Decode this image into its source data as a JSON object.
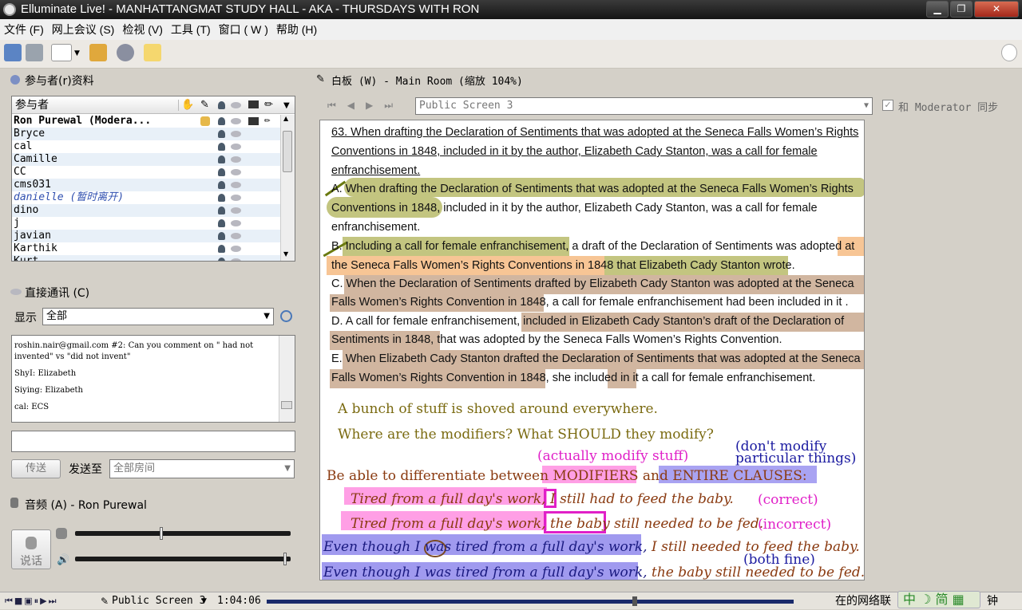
{
  "window": {
    "title": "Elluminate Live! - MANHATTANGMAT STUDY HALL - AKA - THURSDAYS WITH RON"
  },
  "menu": [
    "文件 (F)",
    "网上会议 (S)",
    "检视 (V)",
    "工具 (T)",
    "窗口 ( W )",
    "帮助 (H)"
  ],
  "participants": {
    "title": "参与者(r)资料",
    "column_header": "参与者",
    "rows": [
      {
        "name": "Ron Purewal (Modera...",
        "bold": true
      },
      {
        "name": "Bryce"
      },
      {
        "name": "cal"
      },
      {
        "name": "Camille"
      },
      {
        "name": "CC"
      },
      {
        "name": "cms031"
      },
      {
        "name": "danielle (暂时离开)",
        "away": true
      },
      {
        "name": "dino"
      },
      {
        "name": "j"
      },
      {
        "name": "javian"
      },
      {
        "name": "Karthik"
      },
      {
        "name": "Kurt"
      }
    ]
  },
  "chat": {
    "title": "直接通讯 (C)",
    "show_label": "显示",
    "filter": "全部",
    "messages": [
      "roshin.nair@gmail.com #2: Can you comment on \" had not invented\" vs \"did not invent\"",
      "ShyI: Elizabeth",
      "Siying: Elizabeth",
      "cal: ECS"
    ],
    "send_button": "传送",
    "send_to_label": "发送至",
    "send_to_value": "全部房间"
  },
  "audio": {
    "title": "音频 (A) - Ron Purewal",
    "talk_button": "说话",
    "mic_level": 0.4,
    "speaker_level": 0.98
  },
  "whiteboard": {
    "title": "白板 (W) - Main Room (缩放 104%)",
    "screen": "Public Screen 3",
    "sync_label": "和 Moderator 同步",
    "sync_checked": true,
    "question": [
      "63. When drafting the Declaration of Sentiments that was adopted at the Seneca Falls Women’s Rights",
      "Conventions in 1848, included in it by the author, Elizabeth Cady Stanton, was a call for female",
      "enfranchisement."
    ],
    "choices": [
      [
        "A. When drafting the Declaration of Sentiments that was adopted at the Seneca Falls Women’s Rights",
        "Conventions in 1848, included in it by the author, Elizabeth Cady Stanton, was a call for female",
        "enfranchisement."
      ],
      [
        "B. Including a call for female enfranchisement, a draft of the Declaration of Sentiments was adopted at",
        "the Seneca Falls Women’s Rights Conventions in 1848 that Elizabeth Cady Stanton wrote."
      ],
      [
        "C. When the Declaration of Sentiments drafted by Elizabeth Cady Stanton was adopted at the Seneca",
        "Falls Women’s Rights Convention in 1848, a call for female enfranchisement had been included in it ."
      ],
      [
        "D. A call for female enfranchisement, included in Elizabeth Cady Stanton’s draft of the Declaration of",
        "Sentiments in 1848, that was adopted by the Seneca Falls Women’s Rights Convention."
      ],
      [
        "E. When Elizabeth Cady Stanton drafted the Declaration of Sentiments that was adopted at the Seneca",
        "Falls Women’s Rights Convention in 1848, she included in it a call for female enfranchisement."
      ]
    ],
    "notes": {
      "line1": "A bunch of stuff is shoved around everywhere.",
      "line2": "Where are the modifiers?  What SHOULD they modify?",
      "dont_modify": "(don't modify",
      "particular": "particular things)",
      "actually": "(actually modify stuff)",
      "differentiate": "Be able to differentiate between",
      "modifiers": "MODIFIERS",
      "and": "and",
      "entire": "ENTIRE CLAUSES:",
      "ex1a": "Tired from a full day's work,",
      "ex1b": "I",
      "ex1c": "still had to feed the baby.",
      "correct": "(correct)",
      "ex2a": "Tired from a full day's work,",
      "ex2b": "the baby",
      "ex2c": "still needed to be fed.",
      "incorrect": "(incorrect)",
      "ex3a": "Even though I was tired from a full day's work,",
      "ex3b": "I still needed to feed the baby.",
      "both": "(both fine)",
      "ex4a": "Even though I was tired from a full day's work,",
      "ex4b": "the baby still needed to be fed."
    }
  },
  "status": {
    "screen": "Public Screen 3",
    "time": "1:04:06",
    "right_text": "在的网络联",
    "ime": "中",
    "ime_mode": "简",
    "tail": "钟",
    "progress": 0.7
  }
}
